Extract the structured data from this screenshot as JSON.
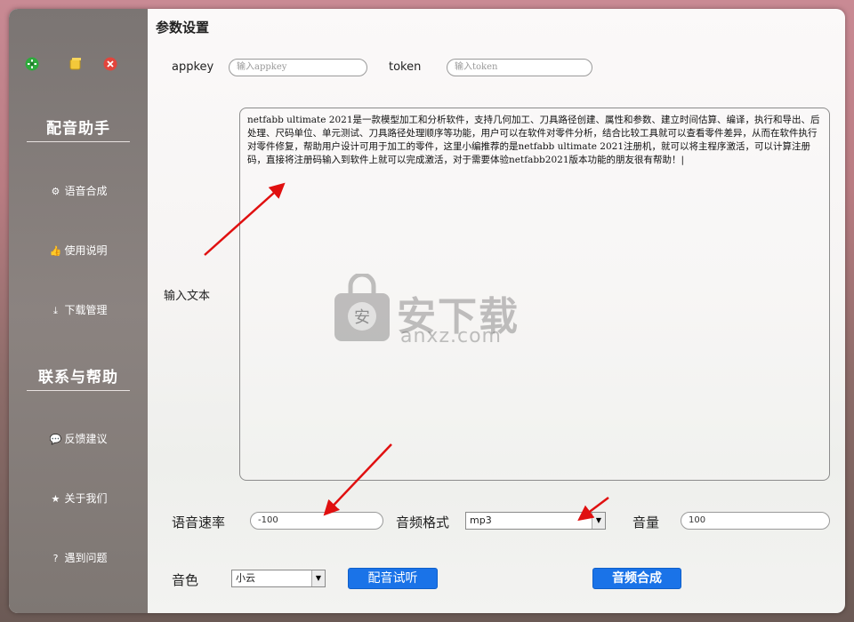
{
  "window_controls": {
    "minimize": "minimize-icon",
    "maximize": "maximize-icon",
    "close": "close-icon"
  },
  "sidebar": {
    "section1_title": "配音助手",
    "section2_title": "联系与帮助",
    "items": [
      {
        "label": "语音合成",
        "icon": "gear-icon"
      },
      {
        "label": "使用说明",
        "icon": "thumb-icon"
      },
      {
        "label": "下载管理",
        "icon": "download-icon"
      },
      {
        "label": "反馈建议",
        "icon": "chat-icon"
      },
      {
        "label": "关于我们",
        "icon": "star-icon"
      },
      {
        "label": "遇到问题",
        "icon": "question-icon"
      }
    ]
  },
  "main": {
    "title": "参数设置",
    "appkey_label": "appkey",
    "appkey_placeholder": "输入appkey",
    "token_label": "token",
    "token_placeholder": "输入token",
    "input_text_label": "输入文本",
    "input_text_value": "netfabb ultimate 2021是一款模型加工和分析软件，支持几何加工、刀具路径创建、属性和参数、建立时间估算、编译，执行和导出、后处理、尺码单位、单元测试、刀具路径处理顺序等功能，用户可以在软件对零件分析，结合比较工具就可以查看零件差异，从而在软件执行对零件修复，帮助用户设计可用于加工的零件，这里小编推荐的是netfabb ultimate 2021注册机，就可以将主程序激活，可以计算注册码，直接将注册码输入到软件上就可以完成激活，对于需要体验netfabb2021版本功能的朋友很有帮助！|",
    "speed_label": "语音速率",
    "speed_value": "-100",
    "format_label": "音频格式",
    "format_value": "mp3",
    "volume_label": "音量",
    "volume_value": "100",
    "voice_label": "音色",
    "voice_value": "小云",
    "preview_button": "配音试听",
    "synthesize_button": "音频合成"
  },
  "watermark": {
    "name": "安下载",
    "url": "anxz.com"
  },
  "colors": {
    "accent": "#1a73e8",
    "sidebar": "#807976",
    "arrow": "#e01010"
  }
}
